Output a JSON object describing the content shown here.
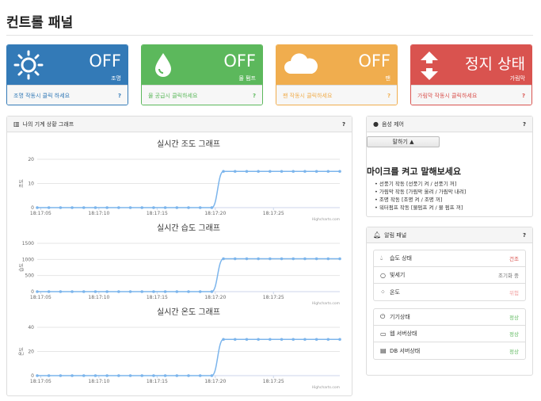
{
  "page": {
    "title": "컨트롤 패널"
  },
  "cards": [
    {
      "status": "OFF",
      "device": "조명",
      "footer": "조명 작동시 클릭 하세요",
      "help": "?",
      "icon": "sun-icon"
    },
    {
      "status": "OFF",
      "device": "물 펌프",
      "footer": "물 공급시 클릭하세요",
      "help": "?",
      "icon": "water-drop-icon"
    },
    {
      "status": "OFF",
      "device": "팬",
      "footer": "팬 작동시 클릭하세요",
      "help": "?",
      "icon": "cloud-icon"
    },
    {
      "status": "정지 상태",
      "device": "가림막",
      "footer": "가림막 작동시 클릭하세요",
      "help": "?",
      "icon": "up-down-arrows-icon"
    }
  ],
  "chart_panel": {
    "title": "나의 기계 상황 그래프",
    "help": "?"
  },
  "chart_data": [
    {
      "type": "line",
      "title": "실시간 조도 그래프",
      "ylabel": "조도",
      "ylim": [
        0,
        20
      ],
      "yticks": [
        0,
        10,
        20
      ],
      "xticks": [
        "18:17:05",
        "18:17:10",
        "18:17:15",
        "18:17:20",
        "18:17:25"
      ],
      "x": [
        0,
        1,
        2,
        3,
        4,
        5,
        6,
        7,
        8,
        9,
        10,
        11,
        12,
        13,
        14,
        15,
        16,
        17,
        18,
        19,
        20,
        21,
        22,
        23,
        24,
        25,
        26
      ],
      "values": [
        0,
        0,
        0,
        0,
        0,
        0,
        0,
        0,
        0,
        0,
        0,
        0,
        0,
        0,
        0,
        0,
        15,
        15,
        15,
        15,
        15,
        15,
        15,
        15,
        15,
        15,
        15
      ],
      "credit": "Highcharts.com"
    },
    {
      "type": "line",
      "title": "실시간 습도 그래프",
      "ylabel": "습도",
      "ylim": [
        0,
        1500
      ],
      "yticks": [
        0,
        500,
        1000,
        1500
      ],
      "xticks": [
        "18:17:05",
        "18:17:10",
        "18:17:15",
        "18:17:20",
        "18:17:25"
      ],
      "x": [
        0,
        1,
        2,
        3,
        4,
        5,
        6,
        7,
        8,
        9,
        10,
        11,
        12,
        13,
        14,
        15,
        16,
        17,
        18,
        19,
        20,
        21,
        22,
        23,
        24,
        25,
        26
      ],
      "values": [
        0,
        0,
        0,
        0,
        0,
        0,
        0,
        0,
        0,
        0,
        0,
        0,
        0,
        0,
        0,
        0,
        1020,
        1020,
        1020,
        1020,
        1020,
        1020,
        1020,
        1020,
        1020,
        1020,
        1020
      ],
      "credit": "Highcharts.com"
    },
    {
      "type": "line",
      "title": "실시간 온도 그래프",
      "ylabel": "온도",
      "ylim": [
        0,
        40
      ],
      "yticks": [
        0,
        20,
        40
      ],
      "xticks": [
        "18:17:05",
        "18:17:10",
        "18:17:15",
        "18:17:20",
        "18:17:25"
      ],
      "x": [
        0,
        1,
        2,
        3,
        4,
        5,
        6,
        7,
        8,
        9,
        10,
        11,
        12,
        13,
        14,
        15,
        16,
        17,
        18,
        19,
        20,
        21,
        22,
        23,
        24,
        25,
        26
      ],
      "values": [
        0,
        0,
        0,
        0,
        0,
        0,
        0,
        0,
        0,
        0,
        0,
        0,
        0,
        0,
        0,
        0,
        30,
        30,
        30,
        30,
        30,
        30,
        30,
        30,
        30,
        30,
        30
      ],
      "credit": "Highcharts.com"
    }
  ],
  "voice_panel": {
    "title": "음성 제어",
    "help": "?",
    "button_label": "말하기 ▲",
    "heading": "마이크를 켜고 말해보세요",
    "commands": [
      "선풍기 작동 [선풍기 켜 / 선풍기 꺼]",
      "가림막 작동 [가림막 올려 / 가림막 내려]",
      "조명 작동 [조명 켜 / 조명 꺼]",
      "워터펌프 작동 [물펌프 켜 / 물 펌프 꺼]"
    ]
  },
  "alert_panel": {
    "title": "알림 패널",
    "help": "?",
    "sensors": [
      {
        "icon": "water-drop-icon",
        "label": "습도 상태",
        "value": "건조",
        "color": "#d9534f"
      },
      {
        "icon": "circle-icon",
        "label": "빛세기",
        "value": "조기화 중",
        "color": "#777777"
      },
      {
        "icon": "spinner-icon",
        "label": "온도",
        "value": "위험",
        "color": "#f2a0a0"
      }
    ],
    "systems": [
      {
        "icon": "power-icon",
        "label": "기기상태",
        "value": "정상",
        "color": "#5cb85c"
      },
      {
        "icon": "monitor-icon",
        "label": "웹 서버상태",
        "value": "정상",
        "color": "#5cb85c"
      },
      {
        "icon": "server-icon",
        "label": "DB 서버상태",
        "value": "정상",
        "color": "#5cb85c"
      }
    ]
  }
}
